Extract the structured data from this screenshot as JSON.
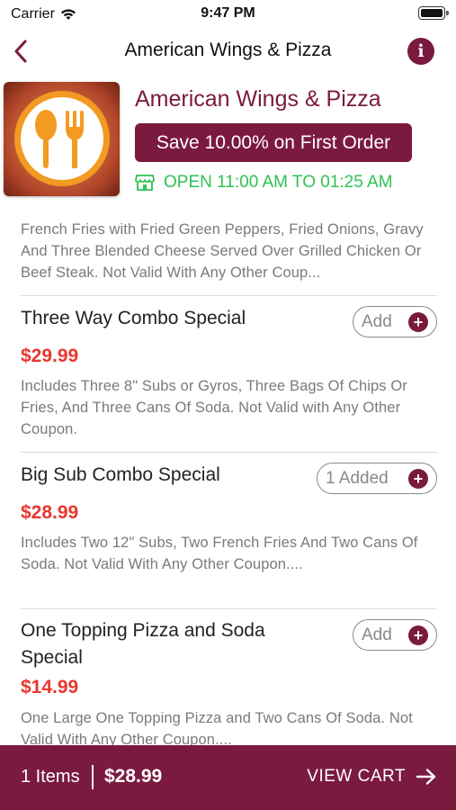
{
  "status_bar": {
    "carrier": "Carrier",
    "time": "9:47 PM"
  },
  "nav": {
    "title": "American Wings & Pizza",
    "info_glyph": "i"
  },
  "restaurant": {
    "name": "American Wings & Pizza",
    "promo": "Save 10.00% on First Order",
    "hours": "OPEN 11:00 AM TO 01:25 AM",
    "hours_color": "#2fc252",
    "brand_color": "#7a1a3f"
  },
  "menu": {
    "partial_description": "French Fries with Fried Green Peppers, Fried Onions, Gravy And Three Blended Cheese Served Over Grilled Chicken Or Beef Steak. Not Valid With Any Other Coup...",
    "items": [
      {
        "title": "Three Way Combo Special",
        "price": "$29.99",
        "description": "Includes Three 8\" Subs or Gyros, Three Bags Of Chips Or Fries, And Three Cans Of Soda. Not Valid with Any Other Coupon.",
        "button": "Add"
      },
      {
        "title": "Big Sub Combo Special",
        "price": "$28.99",
        "description": "Includes Two 12\" Subs, Two French Fries And Two Cans Of Soda. Not Valid With Any Other Coupon....",
        "button": "1 Added"
      },
      {
        "title": "One Topping Pizza and Soda Special",
        "price": "$14.99",
        "description": "One Large One Topping Pizza and Two Cans Of Soda. Not Valid With Any Other Coupon....",
        "button": "Add"
      }
    ],
    "plus_glyph": "+"
  },
  "cart": {
    "count": "1 Items",
    "total": "$28.99",
    "action": "VIEW CART"
  },
  "icons": [
    "wifi-icon",
    "battery-icon",
    "back-chevron-icon",
    "info-icon",
    "store-icon",
    "plus-icon",
    "arrow-right-icon"
  ]
}
